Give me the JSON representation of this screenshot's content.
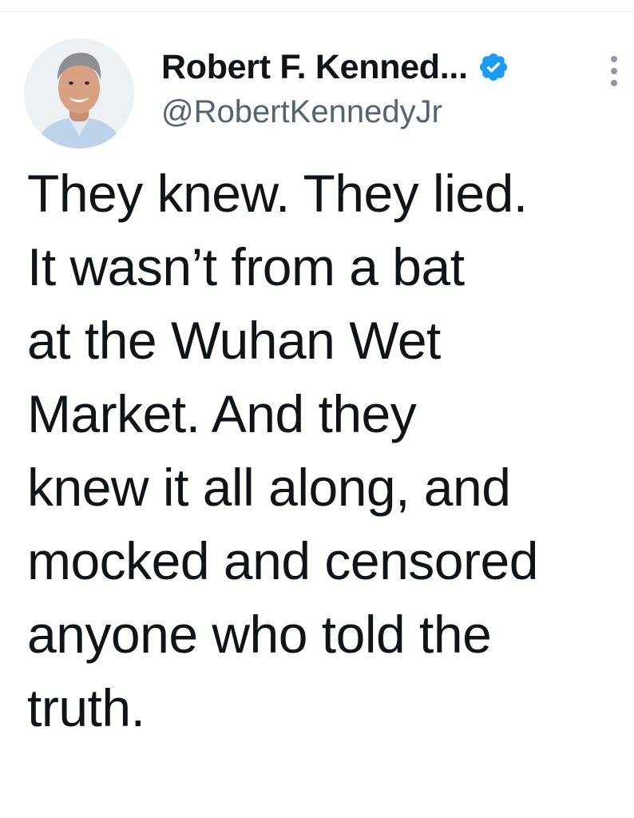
{
  "author": {
    "display_name": "Robert F. Kenned...",
    "handle": "@RobertKennedyJr",
    "verified": true,
    "verified_icon": "verified-badge-icon",
    "verified_color": "#1d9bf0"
  },
  "tweet": {
    "lines": [
      "They knew. They lied.",
      "It wasn’t from a bat",
      "at the Wuhan Wet",
      "Market. And they",
      "knew it all along, and",
      "mocked and censored",
      "anyone who told the",
      "truth."
    ]
  },
  "more_icon": "more-vertical-icon"
}
